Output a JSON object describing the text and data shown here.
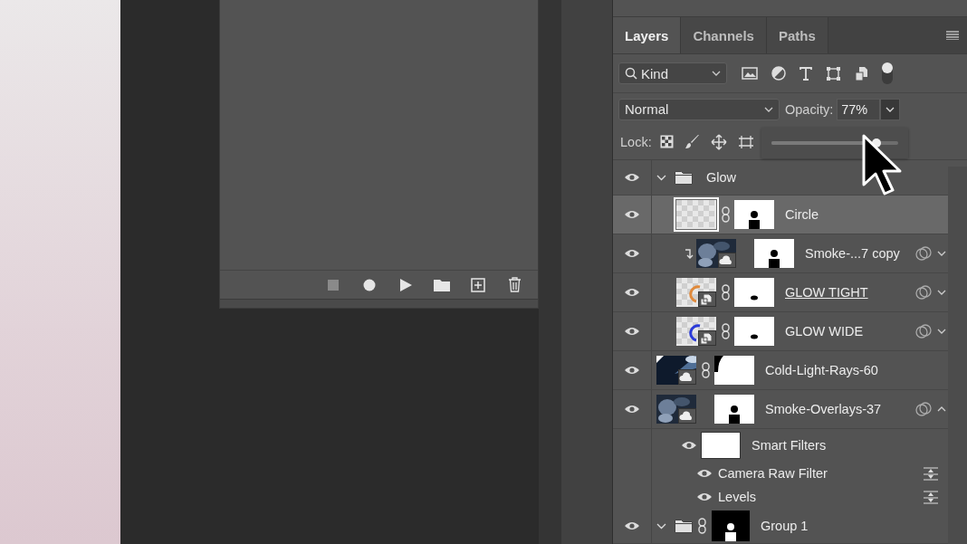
{
  "actions_panel": {
    "buttons": [
      {
        "kind": "stop",
        "disabled": true
      },
      {
        "kind": "record",
        "disabled": false
      },
      {
        "kind": "play",
        "disabled": false
      },
      {
        "kind": "folder",
        "disabled": false
      },
      {
        "kind": "new",
        "disabled": false
      },
      {
        "kind": "delete",
        "disabled": false
      }
    ]
  },
  "tabs": [
    {
      "label": "Layers",
      "selected": true
    },
    {
      "label": "Channels",
      "selected": false
    },
    {
      "label": "Paths",
      "selected": false
    }
  ],
  "filter": {
    "value": "Kind",
    "filter_on": true
  },
  "blend_mode": {
    "value": "Normal"
  },
  "opacity": {
    "label": "Opacity:",
    "value": "77%",
    "popup_open": true,
    "level": 0.77
  },
  "lock": {
    "label": "Lock:"
  },
  "layers": [
    {
      "kind": "group",
      "name": "Glow",
      "visible": true,
      "selected": false,
      "expanded": true,
      "linked": false,
      "children": [
        {
          "kind": "layer",
          "name": "Circle",
          "visible": true,
          "selected": true,
          "clipped": false,
          "linked": true,
          "underlined": false,
          "smart": false,
          "effects": false
        },
        {
          "kind": "layer",
          "name": "Smoke-...7 copy",
          "visible": true,
          "selected": false,
          "clipped": true,
          "linked": false,
          "underlined": false,
          "smart": true,
          "effects": true,
          "expanded": false
        },
        {
          "kind": "layer",
          "name": "GLOW TIGHT",
          "visible": true,
          "selected": false,
          "clipped": false,
          "linked": true,
          "underlined": true,
          "smart": true,
          "effects": true,
          "expanded": false
        },
        {
          "kind": "layer",
          "name": "GLOW WIDE",
          "visible": true,
          "selected": false,
          "clipped": false,
          "linked": true,
          "underlined": false,
          "smart": true,
          "effects": true,
          "expanded": false
        }
      ]
    },
    {
      "kind": "layer",
      "name": "Cold-Light-Rays-60",
      "visible": true,
      "selected": false,
      "clipped": false,
      "linked": true,
      "underlined": false,
      "smart": true,
      "effects": false
    },
    {
      "kind": "layer",
      "name": "Smoke-Overlays-37",
      "visible": true,
      "selected": false,
      "clipped": false,
      "linked": false,
      "underlined": false,
      "smart": true,
      "effects": true,
      "expanded": true,
      "children": [
        {
          "kind": "smart_filters",
          "name": "Smart Filters",
          "visible": true,
          "selected": false
        },
        {
          "kind": "filter",
          "name": "Camera Raw Filter",
          "visible": true,
          "selected": false
        },
        {
          "kind": "filter",
          "name": "Levels",
          "visible": true,
          "selected": false
        }
      ]
    },
    {
      "kind": "group",
      "name": "Group 1",
      "visible": true,
      "selected": false,
      "expanded": true,
      "linked": true
    }
  ]
}
